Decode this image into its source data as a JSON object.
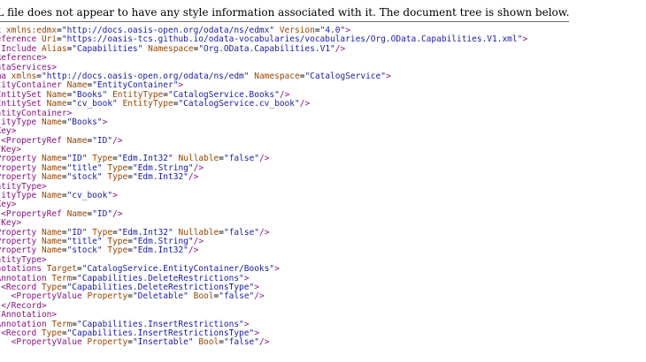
{
  "banner": {
    "text": "This XML file does not appear to have any style information associated with it. The document tree is shown below."
  },
  "colors": {
    "tag": "#881280",
    "attribute_name": "#994500",
    "attribute_value": "#1a1aa6",
    "banner_border": "#6f6f6f"
  },
  "tree_lines": [
    [
      [
        "tag",
        "<edmx:Edmx "
      ],
      [
        "attr",
        "xmlns:edmx"
      ],
      [
        "txt",
        "="
      ],
      [
        "val",
        "\"http://docs.oasis-open.org/odata/ns/edmx\""
      ],
      [
        "txt",
        " "
      ],
      [
        "attr",
        "Version"
      ],
      [
        "txt",
        "="
      ],
      [
        "val",
        "\"4.0\""
      ],
      [
        "tag",
        ">"
      ]
    ],
    [
      [
        "tag",
        "  <edmx:Reference "
      ],
      [
        "attr",
        "Uri"
      ],
      [
        "txt",
        "="
      ],
      [
        "val",
        "\"https://oasis-tcs.github.io/odata-vocabularies/vocabularies/Org.OData.Capabilities.V1.xml\""
      ],
      [
        "tag",
        ">"
      ]
    ],
    [
      [
        "tag",
        "    <edmx:Include "
      ],
      [
        "attr",
        "Alias"
      ],
      [
        "txt",
        "="
      ],
      [
        "val",
        "\"Capabilities\""
      ],
      [
        "txt",
        " "
      ],
      [
        "attr",
        "Namespace"
      ],
      [
        "txt",
        "="
      ],
      [
        "val",
        "\"Org.OData.Capabilities.V1\""
      ],
      [
        "tag",
        "/>"
      ]
    ],
    [
      [
        "tag",
        "  </edmx:Reference>"
      ]
    ],
    [
      [
        "tag",
        "  <edmx:DataServices>"
      ]
    ],
    [
      [
        "tag",
        "    <Schema "
      ],
      [
        "attr",
        "xmlns"
      ],
      [
        "txt",
        "="
      ],
      [
        "val",
        "\"http://docs.oasis-open.org/odata/ns/edm\""
      ],
      [
        "txt",
        " "
      ],
      [
        "attr",
        "Namespace"
      ],
      [
        "txt",
        "="
      ],
      [
        "val",
        "\"CatalogService\""
      ],
      [
        "tag",
        ">"
      ]
    ],
    [
      [
        "tag",
        "      <EntityContainer "
      ],
      [
        "attr",
        "Name"
      ],
      [
        "txt",
        "="
      ],
      [
        "val",
        "\"EntityContainer\""
      ],
      [
        "tag",
        ">"
      ]
    ],
    [
      [
        "tag",
        "        <EntitySet "
      ],
      [
        "attr",
        "Name"
      ],
      [
        "txt",
        "="
      ],
      [
        "val",
        "\"Books\""
      ],
      [
        "txt",
        " "
      ],
      [
        "attr",
        "EntityType"
      ],
      [
        "txt",
        "="
      ],
      [
        "val",
        "\"CatalogService.Books\""
      ],
      [
        "tag",
        "/>"
      ]
    ],
    [
      [
        "tag",
        "        <EntitySet "
      ],
      [
        "attr",
        "Name"
      ],
      [
        "txt",
        "="
      ],
      [
        "val",
        "\"cv_book\""
      ],
      [
        "txt",
        " "
      ],
      [
        "attr",
        "EntityType"
      ],
      [
        "txt",
        "="
      ],
      [
        "val",
        "\"CatalogService.cv_book\""
      ],
      [
        "tag",
        "/>"
      ]
    ],
    [
      [
        "tag",
        "      </EntityContainer>"
      ]
    ],
    [
      [
        "tag",
        "      <EntityType "
      ],
      [
        "attr",
        "Name"
      ],
      [
        "txt",
        "="
      ],
      [
        "val",
        "\"Books\""
      ],
      [
        "tag",
        ">"
      ]
    ],
    [
      [
        "tag",
        "        <Key>"
      ]
    ],
    [
      [
        "tag",
        "          <PropertyRef "
      ],
      [
        "attr",
        "Name"
      ],
      [
        "txt",
        "="
      ],
      [
        "val",
        "\"ID\""
      ],
      [
        "tag",
        "/>"
      ]
    ],
    [
      [
        "tag",
        "        </Key>"
      ]
    ],
    [
      [
        "tag",
        "        <Property "
      ],
      [
        "attr",
        "Name"
      ],
      [
        "txt",
        "="
      ],
      [
        "val",
        "\"ID\""
      ],
      [
        "txt",
        " "
      ],
      [
        "attr",
        "Type"
      ],
      [
        "txt",
        "="
      ],
      [
        "val",
        "\"Edm.Int32\""
      ],
      [
        "txt",
        " "
      ],
      [
        "attr",
        "Nullable"
      ],
      [
        "txt",
        "="
      ],
      [
        "val",
        "\"false\""
      ],
      [
        "tag",
        "/>"
      ]
    ],
    [
      [
        "tag",
        "        <Property "
      ],
      [
        "attr",
        "Name"
      ],
      [
        "txt",
        "="
      ],
      [
        "val",
        "\"title\""
      ],
      [
        "txt",
        " "
      ],
      [
        "attr",
        "Type"
      ],
      [
        "txt",
        "="
      ],
      [
        "val",
        "\"Edm.String\""
      ],
      [
        "tag",
        "/>"
      ]
    ],
    [
      [
        "tag",
        "        <Property "
      ],
      [
        "attr",
        "Name"
      ],
      [
        "txt",
        "="
      ],
      [
        "val",
        "\"stock\""
      ],
      [
        "txt",
        " "
      ],
      [
        "attr",
        "Type"
      ],
      [
        "txt",
        "="
      ],
      [
        "val",
        "\"Edm.Int32\""
      ],
      [
        "tag",
        "/>"
      ]
    ],
    [
      [
        "tag",
        "      </EntityType>"
      ]
    ],
    [
      [
        "tag",
        "      <EntityType "
      ],
      [
        "attr",
        "Name"
      ],
      [
        "txt",
        "="
      ],
      [
        "val",
        "\"cv_book\""
      ],
      [
        "tag",
        ">"
      ]
    ],
    [
      [
        "tag",
        "        <Key>"
      ]
    ],
    [
      [
        "tag",
        "          <PropertyRef "
      ],
      [
        "attr",
        "Name"
      ],
      [
        "txt",
        "="
      ],
      [
        "val",
        "\"ID\""
      ],
      [
        "tag",
        "/>"
      ]
    ],
    [
      [
        "tag",
        "        </Key>"
      ]
    ],
    [
      [
        "tag",
        "        <Property "
      ],
      [
        "attr",
        "Name"
      ],
      [
        "txt",
        "="
      ],
      [
        "val",
        "\"ID\""
      ],
      [
        "txt",
        " "
      ],
      [
        "attr",
        "Type"
      ],
      [
        "txt",
        "="
      ],
      [
        "val",
        "\"Edm.Int32\""
      ],
      [
        "txt",
        " "
      ],
      [
        "attr",
        "Nullable"
      ],
      [
        "txt",
        "="
      ],
      [
        "val",
        "\"false\""
      ],
      [
        "tag",
        "/>"
      ]
    ],
    [
      [
        "tag",
        "        <Property "
      ],
      [
        "attr",
        "Name"
      ],
      [
        "txt",
        "="
      ],
      [
        "val",
        "\"title\""
      ],
      [
        "txt",
        " "
      ],
      [
        "attr",
        "Type"
      ],
      [
        "txt",
        "="
      ],
      [
        "val",
        "\"Edm.String\""
      ],
      [
        "tag",
        "/>"
      ]
    ],
    [
      [
        "tag",
        "        <Property "
      ],
      [
        "attr",
        "Name"
      ],
      [
        "txt",
        "="
      ],
      [
        "val",
        "\"stock\""
      ],
      [
        "txt",
        " "
      ],
      [
        "attr",
        "Type"
      ],
      [
        "txt",
        "="
      ],
      [
        "val",
        "\"Edm.Int32\""
      ],
      [
        "tag",
        "/>"
      ]
    ],
    [
      [
        "tag",
        "      </EntityType>"
      ]
    ],
    [
      [
        "tag",
        "      <Annotations "
      ],
      [
        "attr",
        "Target"
      ],
      [
        "txt",
        "="
      ],
      [
        "val",
        "\"CatalogService.EntityContainer/Books\""
      ],
      [
        "tag",
        ">"
      ]
    ],
    [
      [
        "tag",
        "        <Annotation "
      ],
      [
        "attr",
        "Term"
      ],
      [
        "txt",
        "="
      ],
      [
        "val",
        "\"Capabilities.DeleteRestrictions\""
      ],
      [
        "tag",
        ">"
      ]
    ],
    [
      [
        "tag",
        "          <Record "
      ],
      [
        "attr",
        "Type"
      ],
      [
        "txt",
        "="
      ],
      [
        "val",
        "\"Capabilities.DeleteRestrictionsType\""
      ],
      [
        "tag",
        ">"
      ]
    ],
    [
      [
        "tag",
        "            <PropertyValue "
      ],
      [
        "attr",
        "Property"
      ],
      [
        "txt",
        "="
      ],
      [
        "val",
        "\"Deletable\""
      ],
      [
        "txt",
        " "
      ],
      [
        "attr",
        "Bool"
      ],
      [
        "txt",
        "="
      ],
      [
        "val",
        "\"false\""
      ],
      [
        "tag",
        "/>"
      ]
    ],
    [
      [
        "tag",
        "          </Record>"
      ]
    ],
    [
      [
        "tag",
        "        </Annotation>"
      ]
    ],
    [
      [
        "tag",
        "        <Annotation "
      ],
      [
        "attr",
        "Term"
      ],
      [
        "txt",
        "="
      ],
      [
        "val",
        "\"Capabilities.InsertRestrictions\""
      ],
      [
        "tag",
        ">"
      ]
    ],
    [
      [
        "tag",
        "          <Record "
      ],
      [
        "attr",
        "Type"
      ],
      [
        "txt",
        "="
      ],
      [
        "val",
        "\"Capabilities.InsertRestrictionsType\""
      ],
      [
        "tag",
        ">"
      ]
    ],
    [
      [
        "tag",
        "            <PropertyValue "
      ],
      [
        "attr",
        "Property"
      ],
      [
        "txt",
        "="
      ],
      [
        "val",
        "\"Insertable\""
      ],
      [
        "txt",
        " "
      ],
      [
        "attr",
        "Bool"
      ],
      [
        "txt",
        "="
      ],
      [
        "val",
        "\"false\""
      ],
      [
        "tag",
        "/>"
      ]
    ]
  ]
}
